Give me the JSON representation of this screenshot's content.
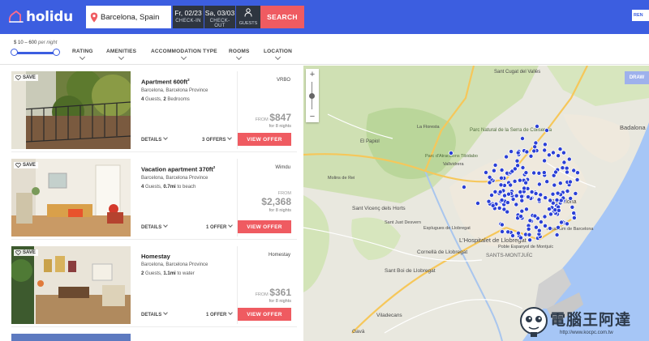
{
  "header": {
    "logo_text": "holidu",
    "destination": "Barcelona, Spain",
    "checkin_date": "Fr, 02/23",
    "checkin_label": "CHECK-IN",
    "checkout_date": "Sa, 03/03",
    "checkout_label": "CHECK-OUT",
    "guests_label": "GUESTS",
    "search_label": "SEARCH",
    "rent_label": "REN",
    "brand_color": "#3c5ee0",
    "accent_color": "#ef5b61"
  },
  "filters": {
    "price_range": "$ 10 – 600",
    "price_unit": "per night",
    "items": [
      "RATING",
      "AMENITIES",
      "ACCOMMODATION TYPE",
      "ROOMS",
      "LOCATION"
    ]
  },
  "listings": [
    {
      "save_label": "SAVE",
      "title": "Apartment 600ft",
      "title_sup": "2",
      "location": "Barcelona, Barcelona Province",
      "feat_bold_1": "4",
      "feat_text_1": " Guests, ",
      "feat_bold_2": "2",
      "feat_text_2": " Bedrooms",
      "partner": "VRBO",
      "from_label": "FROM",
      "price": "$847",
      "nights": "for 8 nights",
      "details_label": "DETAILS",
      "offers_label": "3 OFFERS",
      "button_label": "VIEW OFFER"
    },
    {
      "save_label": "SAVE",
      "title": "Vacation apartment 370ft",
      "title_sup": "2",
      "location": "Barcelona, Barcelona Province",
      "feat_bold_1": "4",
      "feat_text_1": " Guests, ",
      "feat_bold_2": "0.7mi",
      "feat_text_2": " to beach",
      "partner": "Wimdu",
      "from_label": "FROM",
      "price": "$2,368",
      "nights": "for 8 nights",
      "details_label": "DETAILS",
      "offers_label": "1 OFFER",
      "button_label": "VIEW OFFER"
    },
    {
      "save_label": "SAVE",
      "title": "Homestay",
      "title_sup": "",
      "location": "Barcelona, Barcelona Province",
      "feat_bold_1": "2",
      "feat_text_1": " Guests, ",
      "feat_bold_2": "1.1mi",
      "feat_text_2": " to water",
      "partner": "Homestay",
      "from_label": "FROM",
      "price": "$361",
      "nights": "for 8 nights",
      "details_label": "DETAILS",
      "offers_label": "1 OFFER",
      "button_label": "VIEW OFFER"
    }
  ],
  "map": {
    "zoom_in": "+",
    "zoom_out": "−",
    "draw_label": "DRAW",
    "labels": {
      "badalona": "Badalona",
      "sant_cugat": "Sant Cugat del Vallès",
      "parc_serra": "Parc Natural de la Serra de Collserola",
      "parc_atraccions": "Parc d'Atraccions Tibidabo",
      "la_floresta": "La Floresta",
      "el_papiol": "El Papiol",
      "sant_vicenc": "Sant Vicenç dels Horts",
      "hospitalet": "L'Hospitalet de Llobregat",
      "cornella": "Cornellà de Llobregat",
      "sant_boi": "Sant Boi de Llobregat",
      "viladecans": "Viladecans",
      "gava": "Gavà",
      "barcelona": "Barcelona",
      "aquarium": "Aquàrium de Barcelona",
      "montjuic": "SANTS-MONTJUÏC",
      "poble_espanyol": "Poble Espanyol de Montjuïc",
      "collserola": "Collserola",
      "esplugues": "Esplugues de Llobregat",
      "molins": "Molins de Rei",
      "sant_just": "Sant Just Desvern",
      "vallvidrera": "Vallvidrera"
    }
  },
  "watermark": {
    "text": "電腦王阿達",
    "url": "http://www.kocpc.com.tw"
  }
}
